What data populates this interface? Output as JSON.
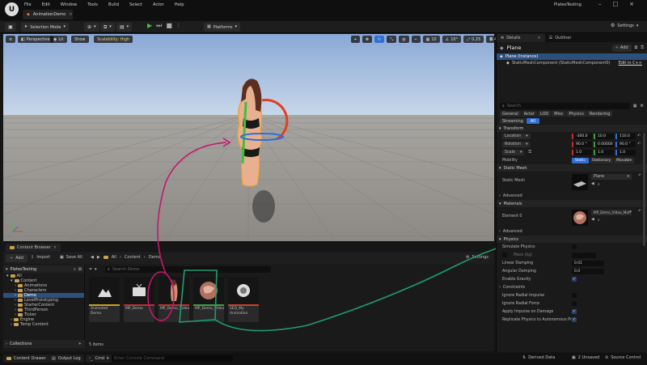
{
  "menu": {
    "items": [
      "File",
      "Edit",
      "Window",
      "Tools",
      "Build",
      "Select",
      "Actor",
      "Help"
    ]
  },
  "project_tab": "AnimationDemo",
  "project_name": "PlatesTesting",
  "toolbar": {
    "selection_mode": "Selection Mode",
    "platforms": "Platforms",
    "settings": "Settings"
  },
  "viewport": {
    "perspective": "Perspective",
    "lit": "Lit",
    "show": "Show",
    "scalability": "Scalability: High",
    "grid_snap": "10",
    "angle_snap": "10°",
    "scale_snap": "0.25",
    "camera_speed": "4"
  },
  "content_browser": {
    "tab": "Content Browser",
    "add": "Add",
    "import": "Import",
    "save_all": "Save All",
    "path": [
      "All",
      "Content",
      "Demo"
    ],
    "settings": "Settings",
    "tree_root": "PlatesTesting",
    "tree": [
      {
        "label": "All",
        "depth": 0
      },
      {
        "label": "Content",
        "depth": 1
      },
      {
        "label": "Animations",
        "depth": 2
      },
      {
        "label": "Characters",
        "depth": 2
      },
      {
        "label": "Demo",
        "depth": 2,
        "selected": true
      },
      {
        "label": "LevelPrototyping",
        "depth": 2
      },
      {
        "label": "StarterContent",
        "depth": 2
      },
      {
        "label": "ThirdPerson",
        "depth": 2
      },
      {
        "label": "Ticker",
        "depth": 2
      },
      {
        "label": "Engine",
        "depth": 1
      },
      {
        "label": "Temp Content",
        "depth": 1
      }
    ],
    "search_placeholder": "Search Demo",
    "assets": [
      {
        "label": "Animated Demo",
        "bar": "#c8a020"
      },
      {
        "label": "MP_Demo",
        "bar": "#c03030"
      },
      {
        "label": "MP_Demo_Video",
        "bar": "#c03030"
      },
      {
        "label": "MP_Demo_Video_Mat",
        "bar": "#3aa040"
      },
      {
        "label": "SEQ_My Animation",
        "bar": "#c84030"
      }
    ],
    "item_count": "5 items",
    "collections": "Collections"
  },
  "status": {
    "content_drawer": "Content Drawer",
    "output_log": "Output Log",
    "cmd": "Cmd",
    "console_placeholder": "Enter Console Command",
    "derived_data": "Derived Data",
    "unsaved": "2 Unsaved",
    "source_control": "Source Control"
  },
  "details": {
    "tab_details": "Details",
    "tab_outliner": "Outliner",
    "actor_name": "Plane",
    "add": "Add",
    "instance": "Plane (Instance)",
    "component": "StaticMeshComponent (StaticMeshComponent0)",
    "edit_cpp": "Edit in C++",
    "search_placeholder": "Search",
    "filters_row1": [
      "General",
      "Actor",
      "LOD",
      "Misc",
      "Physics",
      "Rendering"
    ],
    "filters_row2": [
      "Streaming",
      "All"
    ],
    "transform": "Transform",
    "location_label": "Location",
    "location": [
      "-300.0",
      "10.0",
      "110.0"
    ],
    "rotation_label": "Rotation",
    "rotation": [
      "90.0 °",
      "0.00000",
      "90.0 °"
    ],
    "scale_label": "Scale",
    "scale": [
      "1.0",
      "1.0",
      "1.0"
    ],
    "mobility_label": "Mobility",
    "mobility": [
      "Static",
      "Stationary",
      "Movable"
    ],
    "static_mesh_section": "Static Mesh",
    "static_mesh_label": "Static Mesh",
    "static_mesh_value": "Plane",
    "advanced": "Advanced",
    "materials_section": "Materials",
    "element0_label": "Element 0",
    "element0_value": "MP_Demo_Video_Mat",
    "physics_section": "Physics",
    "physics_props": [
      {
        "label": "Simulate Physics",
        "type": "check",
        "on": false
      },
      {
        "label": "Mass (kg)",
        "type": "check",
        "on": false
      },
      {
        "label": "Linear Damping",
        "type": "num",
        "value": "0.01"
      },
      {
        "label": "Angular Damping",
        "type": "num",
        "value": "0.0"
      },
      {
        "label": "Enable Gravity",
        "type": "check",
        "on": true
      }
    ],
    "constraints_section": "Constraints",
    "constraint_props": [
      {
        "label": "Ignore Radial Impulse",
        "on": false
      },
      {
        "label": "Ignore Radial Force",
        "on": false
      },
      {
        "label": "Apply Impulse on Damage",
        "on": true
      },
      {
        "label": "Replicate Physics to Autonomous Pr...",
        "on": true
      }
    ]
  },
  "colors": {
    "annotation_pink": "#c4176a",
    "annotation_green": "#1e9e6e",
    "play_green": "#3ec13e",
    "accent_blue": "#2f6fd8"
  }
}
